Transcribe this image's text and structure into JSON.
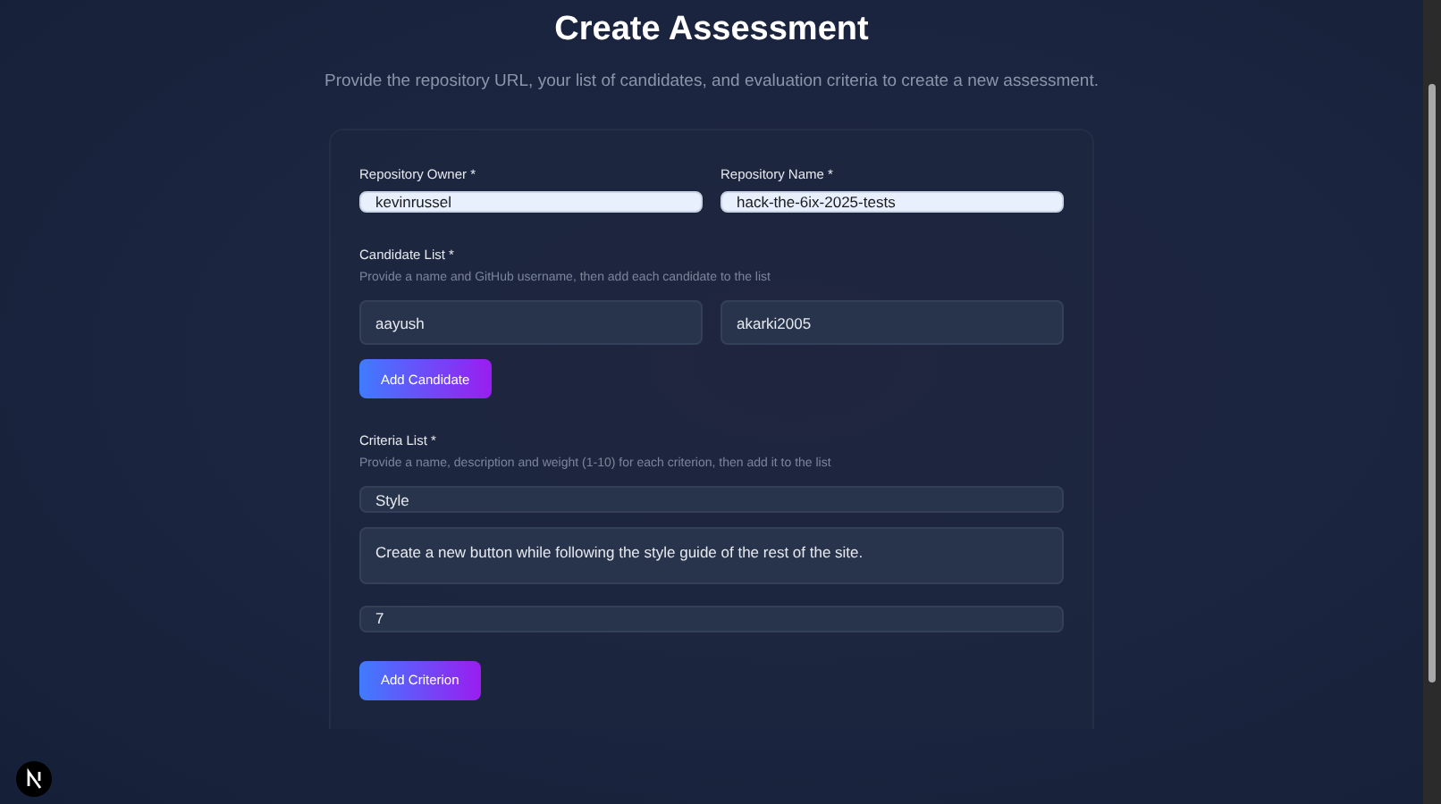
{
  "title": "Create Assessment",
  "subtitle": "Provide the repository URL, your list of candidates, and evaluation criteria to create a new assessment.",
  "repository_fields": [
    {
      "label": "Repository Owner *",
      "value": "kevinrussel"
    },
    {
      "label": "Repository Name *",
      "value": "hack-the-6ix-2025-tests"
    }
  ],
  "candidate_list": {
    "label": "Candidate List *",
    "hint": "Provide a name and GitHub username, then add each candidate to the list",
    "name_value": "aayush",
    "username_value": "akarki2005",
    "button": "Add Candidate"
  },
  "criteria_list": {
    "label": "Criteria List *",
    "hint": "Provide a name, description and weight (1-10) for each criterion, then add it to the list",
    "name_value": "Style",
    "description_value": "Create a new button while following the style guide of the rest of the site.",
    "weight_value": "7",
    "button": "Add Criterion"
  }
}
